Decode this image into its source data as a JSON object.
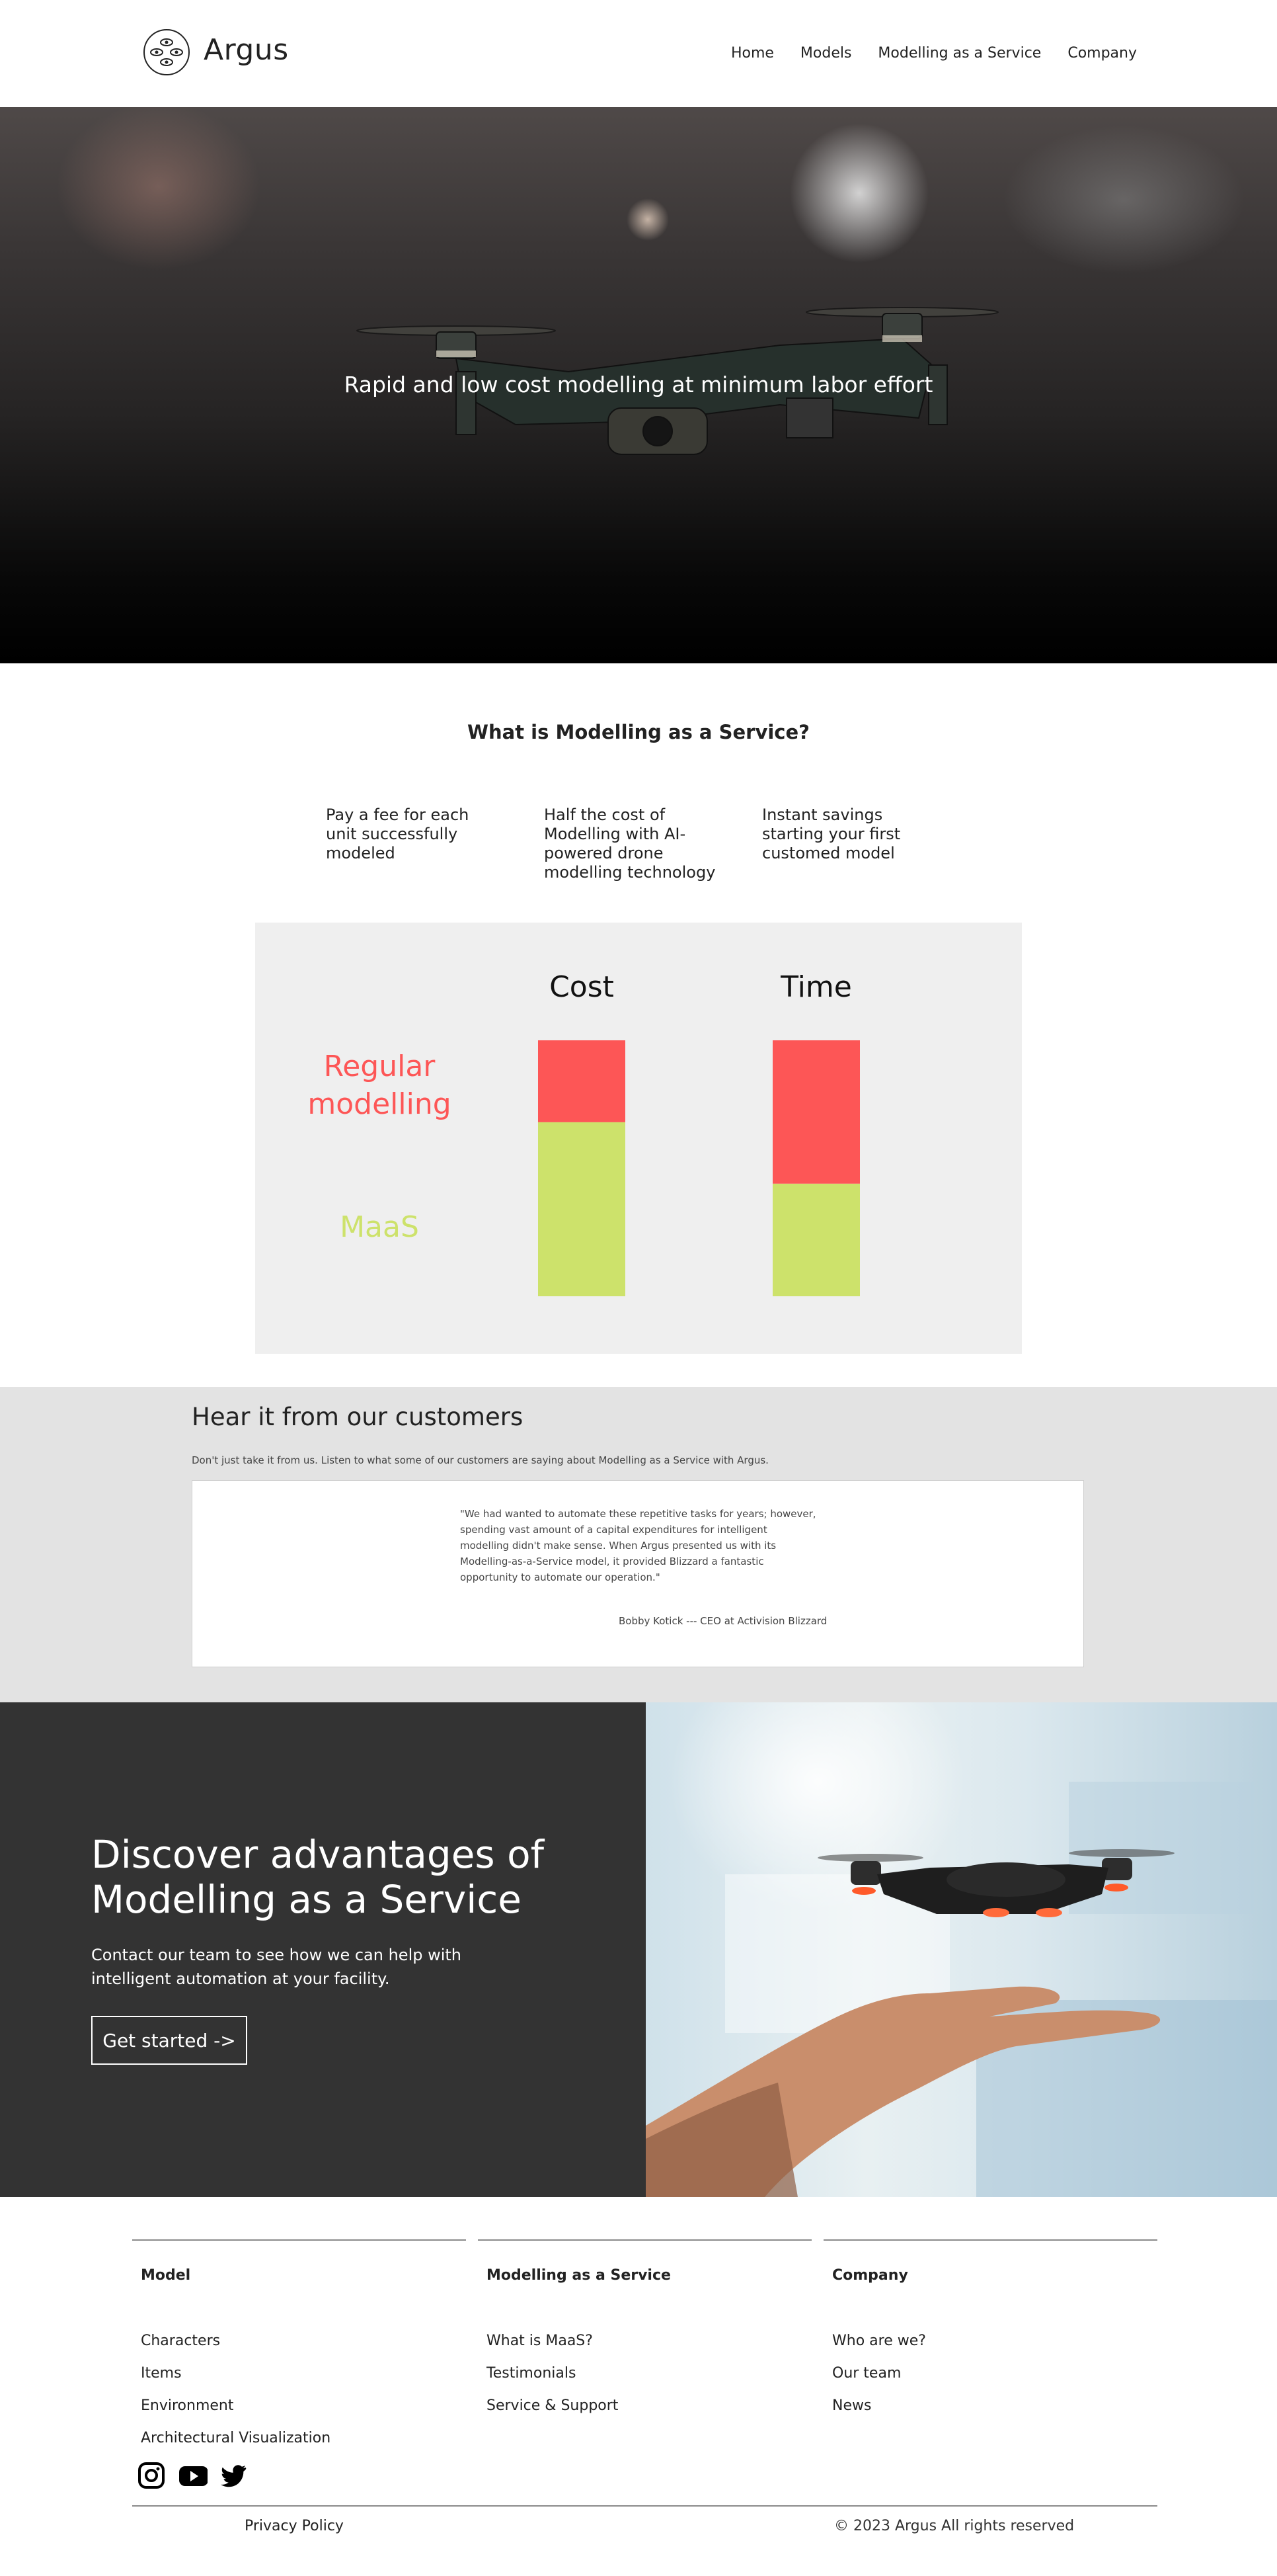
{
  "header": {
    "brand": "Argus",
    "nav": [
      "Home",
      "Models",
      "Modelling as a Service",
      "Company"
    ]
  },
  "hero": {
    "tagline": "Rapid and low cost modelling at minimum labor effort"
  },
  "maas": {
    "title": "What is Modelling as a Service?",
    "features": [
      "Pay a fee for each unit successfully modeled",
      "Half the cost of Modelling with AI-powered drone modelling technology",
      "Instant savings starting your first customed model"
    ]
  },
  "chart_data": {
    "type": "bar",
    "stacked": true,
    "categories": [
      "Cost",
      "Time"
    ],
    "series": [
      {
        "name": "MaaS",
        "values": [
          0.68,
          0.44
        ],
        "color": "#cde26b"
      },
      {
        "name": "Regular modelling",
        "values": [
          0.32,
          0.56
        ],
        "color": "#fd5656"
      }
    ],
    "series_labels": {
      "regular": "Regular modelling",
      "maas": "MaaS"
    },
    "grid": false,
    "background": "#efefef"
  },
  "testimonials": {
    "title": "Hear it from our customers",
    "subtitle": "Don't just take it from us. Listen to what some of our customers are saying about Modelling as a Service with Argus.",
    "quote": "\"We had wanted to automate these repetitive tasks for years; however, spending vast amount of a capital expenditures for intelligent modelling didn't make sense. When Argus presented us with its Modelling-as-a-Service model, it provided Blizzard a fantastic opportunity to automate our operation.\"",
    "author": "Bobby Kotick --- CEO at Activision Blizzard"
  },
  "cta": {
    "title": "Discover advantages of Modelling as a Service",
    "text": "Contact our team to see how we can help with intelligent automation at your facility.",
    "button": "Get started ->"
  },
  "footer": {
    "columns": [
      {
        "heading": "Model",
        "links": [
          "Characters",
          "Items",
          "Environment",
          "Architectural Visualization"
        ]
      },
      {
        "heading": "Modelling as a Service",
        "links": [
          "What is MaaS?",
          "Testimonials",
          "Service & Support"
        ]
      },
      {
        "heading": "Company",
        "links": [
          "Who are we?",
          "Our team",
          "News"
        ]
      }
    ],
    "social": [
      "instagram-icon",
      "youtube-icon",
      "twitter-icon"
    ],
    "privacy": "Privacy Policy",
    "copyright": "© 2023 Argus All rights reserved"
  }
}
